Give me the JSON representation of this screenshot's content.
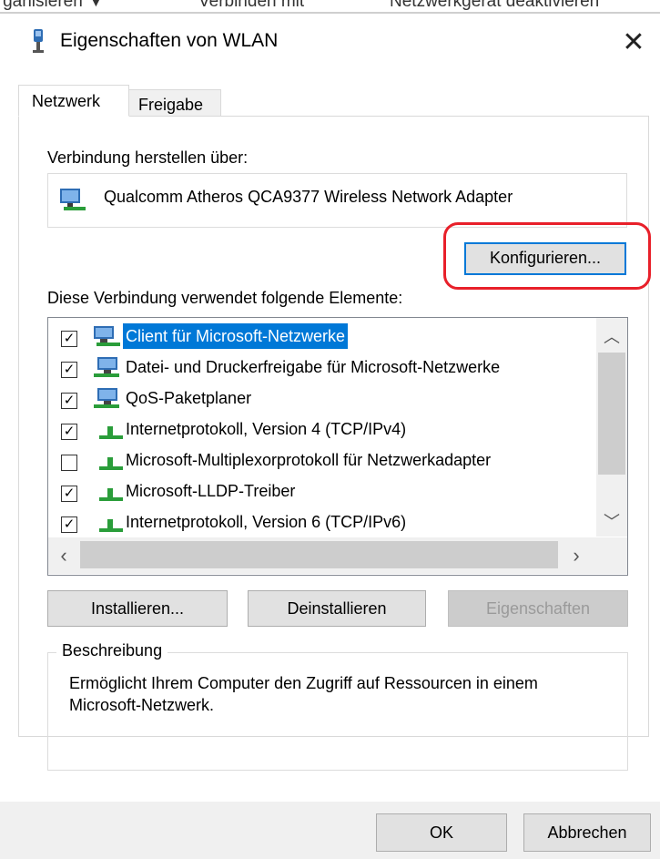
{
  "explorer_toolbar": {
    "items": [
      "Organisieren ▼",
      "Verbinden mit",
      "Netzwerkgerät deaktivieren"
    ]
  },
  "dialog": {
    "title": "Eigenschaften von WLAN",
    "close_symbol": "✕",
    "tabs": [
      {
        "label": "Netzwerk",
        "active": true
      },
      {
        "label": "Freigabe",
        "active": false
      }
    ],
    "connect_using_label": "Verbindung herstellen über:",
    "adapter_name": "Qualcomm Atheros QCA9377 Wireless Network Adapter",
    "configure_button": "Konfigurieren...",
    "items_label": "Diese Verbindung verwendet folgende Elemente:",
    "components": [
      {
        "label": "Client für Microsoft-Netzwerke",
        "checked": true,
        "selected": true,
        "icon": "network-client-icon"
      },
      {
        "label": "Datei- und Druckerfreigabe für Microsoft-Netzwerke",
        "checked": true,
        "selected": false,
        "icon": "network-service-icon"
      },
      {
        "label": "QoS-Paketplaner",
        "checked": true,
        "selected": false,
        "icon": "network-service-icon"
      },
      {
        "label": "Internetprotokoll, Version 4 (TCP/IPv4)",
        "checked": true,
        "selected": false,
        "icon": "protocol-icon"
      },
      {
        "label": "Microsoft-Multiplexorprotokoll für Netzwerkadapter",
        "checked": false,
        "selected": false,
        "icon": "protocol-icon"
      },
      {
        "label": "Microsoft-LLDP-Treiber",
        "checked": true,
        "selected": false,
        "icon": "protocol-icon"
      },
      {
        "label": "Internetprotokoll, Version 6 (TCP/IPv6)",
        "checked": true,
        "selected": false,
        "icon": "protocol-icon"
      }
    ],
    "install_button": "Installieren...",
    "uninstall_button": "Deinstallieren",
    "properties_button": "Eigenschaften",
    "description_legend": "Beschreibung",
    "description_text": "Ermöglicht Ihrem Computer den Zugriff auf Ressourcen in einem Microsoft-Netzwerk.",
    "ok_button": "OK",
    "cancel_button": "Abbrechen"
  },
  "colors": {
    "selection": "#0078d7",
    "highlight_ring": "#e8202a",
    "button_face": "#e1e1e1"
  }
}
